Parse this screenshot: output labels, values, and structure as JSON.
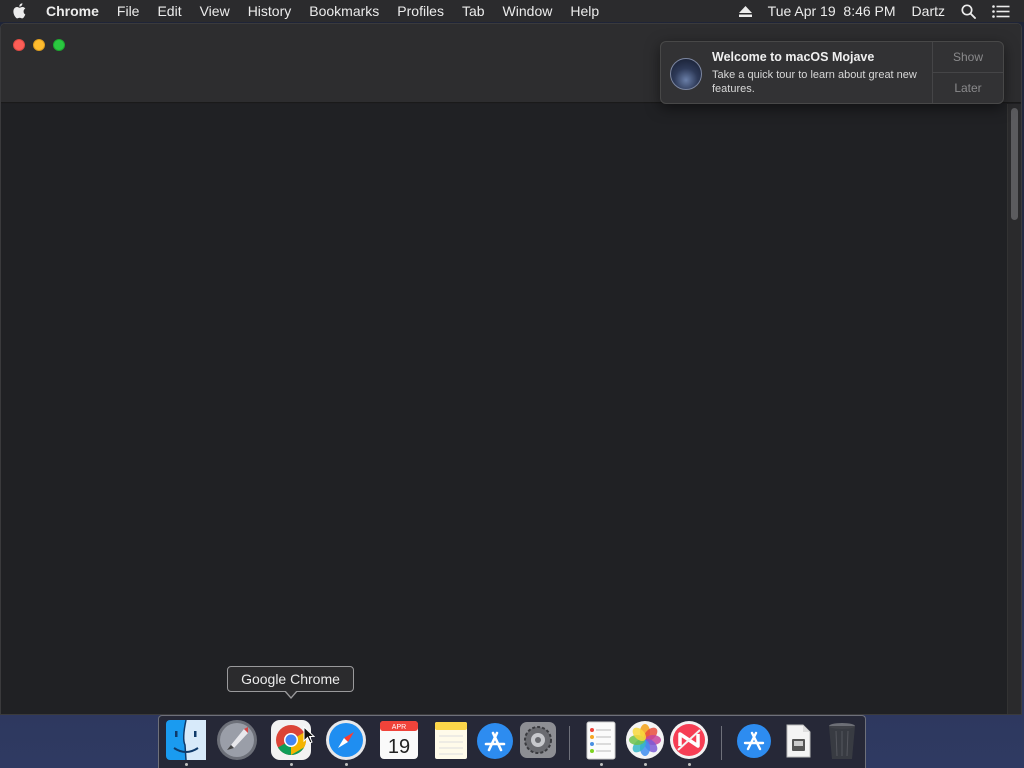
{
  "menubar": {
    "apple_icon": "apple-icon",
    "app_name": "Chrome",
    "menus": [
      "File",
      "Edit",
      "View",
      "History",
      "Bookmarks",
      "Profiles",
      "Tab",
      "Window",
      "Help"
    ],
    "eject_icon": "eject-icon",
    "clock": "Tue Apr 19  8:46 PM",
    "user": "Dartz",
    "search_icon": "spotlight-search-icon",
    "notification_center_icon": "list-icon"
  },
  "notification": {
    "icon": "macos-mojave-icon",
    "title": "Welcome to macOS Mojave",
    "body": "Take a quick tour to learn about great new features.",
    "actions": [
      "Show",
      "Later"
    ]
  },
  "tooltip": {
    "text": "Google Chrome"
  },
  "calendar": {
    "month": "APR",
    "day": "19"
  },
  "dock": {
    "items": [
      {
        "name": "finder-icon",
        "running": true
      },
      {
        "name": "launchpad-icon",
        "running": false
      },
      {
        "name": "google-chrome-icon",
        "running": true
      },
      {
        "name": "safari-icon",
        "running": true
      },
      {
        "name": "calendar-icon",
        "running": false
      },
      {
        "name": "notes-icon",
        "running": false
      },
      {
        "name": "app-store-icon",
        "running": false
      },
      {
        "name": "system-preferences-icon",
        "running": false
      },
      {
        "name": "reminders-icon",
        "running": true
      },
      {
        "name": "photos-icon",
        "running": true
      },
      {
        "name": "news-icon",
        "running": true
      },
      {
        "name": "app-store-downloads-icon",
        "running": false
      },
      {
        "name": "document-icon",
        "running": false
      },
      {
        "name": "trash-icon",
        "running": false
      }
    ]
  },
  "colors": {
    "close": "#fd5e57",
    "minimize": "#febc2e",
    "maximize": "#2ac840",
    "window_bg": "#202124",
    "menubar_bg": "#2b2b2d"
  }
}
